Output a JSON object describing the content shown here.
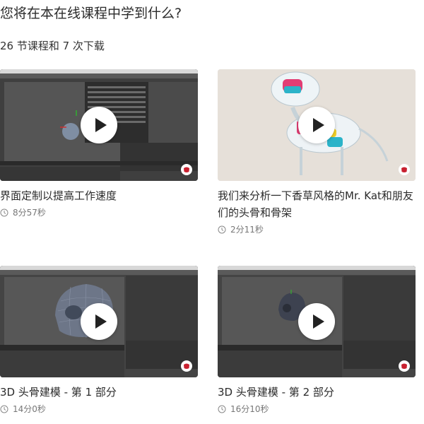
{
  "page": {
    "heading": "您将在本在线课程中学到什么?",
    "summary": "26 节课程和 7 次下载"
  },
  "colors": {
    "brand_badge": "#c8202f",
    "play_button": "#ffffff",
    "play_triangle": "#222222"
  },
  "lessons": [
    {
      "title": "界面定制以提高工作速度",
      "duration": "8分57秒",
      "thumbnail": "c4d-interface-screenshot"
    },
    {
      "title": "我们来分析一下香草风格的Mr. Kat和朋友们的头骨和骨架",
      "duration": "2分11秒",
      "thumbnail": "transparent-cat-character-render"
    },
    {
      "title": "3D 头骨建模 - 第 1 部分",
      "duration": "14分0秒",
      "thumbnail": "skull-wireframe-closeup"
    },
    {
      "title": "3D 头骨建模 - 第 2 部分",
      "duration": "16分10秒",
      "thumbnail": "skull-model-small"
    }
  ],
  "icons": {
    "play": "play-icon",
    "duration": "clock-icon",
    "badge": "domestika-logo-icon"
  }
}
